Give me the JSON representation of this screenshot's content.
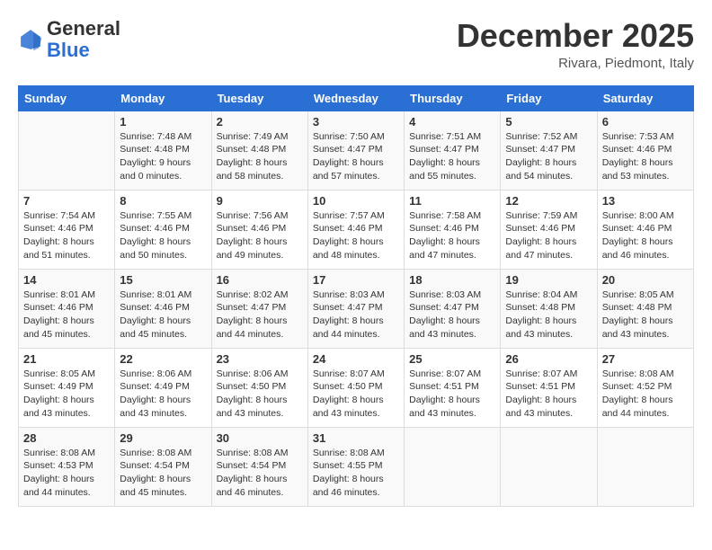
{
  "header": {
    "logo_general": "General",
    "logo_blue": "Blue",
    "month_title": "December 2025",
    "location": "Rivara, Piedmont, Italy"
  },
  "days_of_week": [
    "Sunday",
    "Monday",
    "Tuesday",
    "Wednesday",
    "Thursday",
    "Friday",
    "Saturday"
  ],
  "weeks": [
    [
      {
        "day": "",
        "sunrise": "",
        "sunset": "",
        "daylight": ""
      },
      {
        "day": "1",
        "sunrise": "7:48 AM",
        "sunset": "4:48 PM",
        "daylight": "9 hours and 0 minutes."
      },
      {
        "day": "2",
        "sunrise": "7:49 AM",
        "sunset": "4:48 PM",
        "daylight": "8 hours and 58 minutes."
      },
      {
        "day": "3",
        "sunrise": "7:50 AM",
        "sunset": "4:47 PM",
        "daylight": "8 hours and 57 minutes."
      },
      {
        "day": "4",
        "sunrise": "7:51 AM",
        "sunset": "4:47 PM",
        "daylight": "8 hours and 55 minutes."
      },
      {
        "day": "5",
        "sunrise": "7:52 AM",
        "sunset": "4:47 PM",
        "daylight": "8 hours and 54 minutes."
      },
      {
        "day": "6",
        "sunrise": "7:53 AM",
        "sunset": "4:46 PM",
        "daylight": "8 hours and 53 minutes."
      }
    ],
    [
      {
        "day": "7",
        "sunrise": "7:54 AM",
        "sunset": "4:46 PM",
        "daylight": "8 hours and 51 minutes."
      },
      {
        "day": "8",
        "sunrise": "7:55 AM",
        "sunset": "4:46 PM",
        "daylight": "8 hours and 50 minutes."
      },
      {
        "day": "9",
        "sunrise": "7:56 AM",
        "sunset": "4:46 PM",
        "daylight": "8 hours and 49 minutes."
      },
      {
        "day": "10",
        "sunrise": "7:57 AM",
        "sunset": "4:46 PM",
        "daylight": "8 hours and 48 minutes."
      },
      {
        "day": "11",
        "sunrise": "7:58 AM",
        "sunset": "4:46 PM",
        "daylight": "8 hours and 47 minutes."
      },
      {
        "day": "12",
        "sunrise": "7:59 AM",
        "sunset": "4:46 PM",
        "daylight": "8 hours and 47 minutes."
      },
      {
        "day": "13",
        "sunrise": "8:00 AM",
        "sunset": "4:46 PM",
        "daylight": "8 hours and 46 minutes."
      }
    ],
    [
      {
        "day": "14",
        "sunrise": "8:01 AM",
        "sunset": "4:46 PM",
        "daylight": "8 hours and 45 minutes."
      },
      {
        "day": "15",
        "sunrise": "8:01 AM",
        "sunset": "4:46 PM",
        "daylight": "8 hours and 45 minutes."
      },
      {
        "day": "16",
        "sunrise": "8:02 AM",
        "sunset": "4:47 PM",
        "daylight": "8 hours and 44 minutes."
      },
      {
        "day": "17",
        "sunrise": "8:03 AM",
        "sunset": "4:47 PM",
        "daylight": "8 hours and 44 minutes."
      },
      {
        "day": "18",
        "sunrise": "8:03 AM",
        "sunset": "4:47 PM",
        "daylight": "8 hours and 43 minutes."
      },
      {
        "day": "19",
        "sunrise": "8:04 AM",
        "sunset": "4:48 PM",
        "daylight": "8 hours and 43 minutes."
      },
      {
        "day": "20",
        "sunrise": "8:05 AM",
        "sunset": "4:48 PM",
        "daylight": "8 hours and 43 minutes."
      }
    ],
    [
      {
        "day": "21",
        "sunrise": "8:05 AM",
        "sunset": "4:49 PM",
        "daylight": "8 hours and 43 minutes."
      },
      {
        "day": "22",
        "sunrise": "8:06 AM",
        "sunset": "4:49 PM",
        "daylight": "8 hours and 43 minutes."
      },
      {
        "day": "23",
        "sunrise": "8:06 AM",
        "sunset": "4:50 PM",
        "daylight": "8 hours and 43 minutes."
      },
      {
        "day": "24",
        "sunrise": "8:07 AM",
        "sunset": "4:50 PM",
        "daylight": "8 hours and 43 minutes."
      },
      {
        "day": "25",
        "sunrise": "8:07 AM",
        "sunset": "4:51 PM",
        "daylight": "8 hours and 43 minutes."
      },
      {
        "day": "26",
        "sunrise": "8:07 AM",
        "sunset": "4:51 PM",
        "daylight": "8 hours and 43 minutes."
      },
      {
        "day": "27",
        "sunrise": "8:08 AM",
        "sunset": "4:52 PM",
        "daylight": "8 hours and 44 minutes."
      }
    ],
    [
      {
        "day": "28",
        "sunrise": "8:08 AM",
        "sunset": "4:53 PM",
        "daylight": "8 hours and 44 minutes."
      },
      {
        "day": "29",
        "sunrise": "8:08 AM",
        "sunset": "4:54 PM",
        "daylight": "8 hours and 45 minutes."
      },
      {
        "day": "30",
        "sunrise": "8:08 AM",
        "sunset": "4:54 PM",
        "daylight": "8 hours and 46 minutes."
      },
      {
        "day": "31",
        "sunrise": "8:08 AM",
        "sunset": "4:55 PM",
        "daylight": "8 hours and 46 minutes."
      },
      {
        "day": "",
        "sunrise": "",
        "sunset": "",
        "daylight": ""
      },
      {
        "day": "",
        "sunrise": "",
        "sunset": "",
        "daylight": ""
      },
      {
        "day": "",
        "sunrise": "",
        "sunset": "",
        "daylight": ""
      }
    ]
  ]
}
